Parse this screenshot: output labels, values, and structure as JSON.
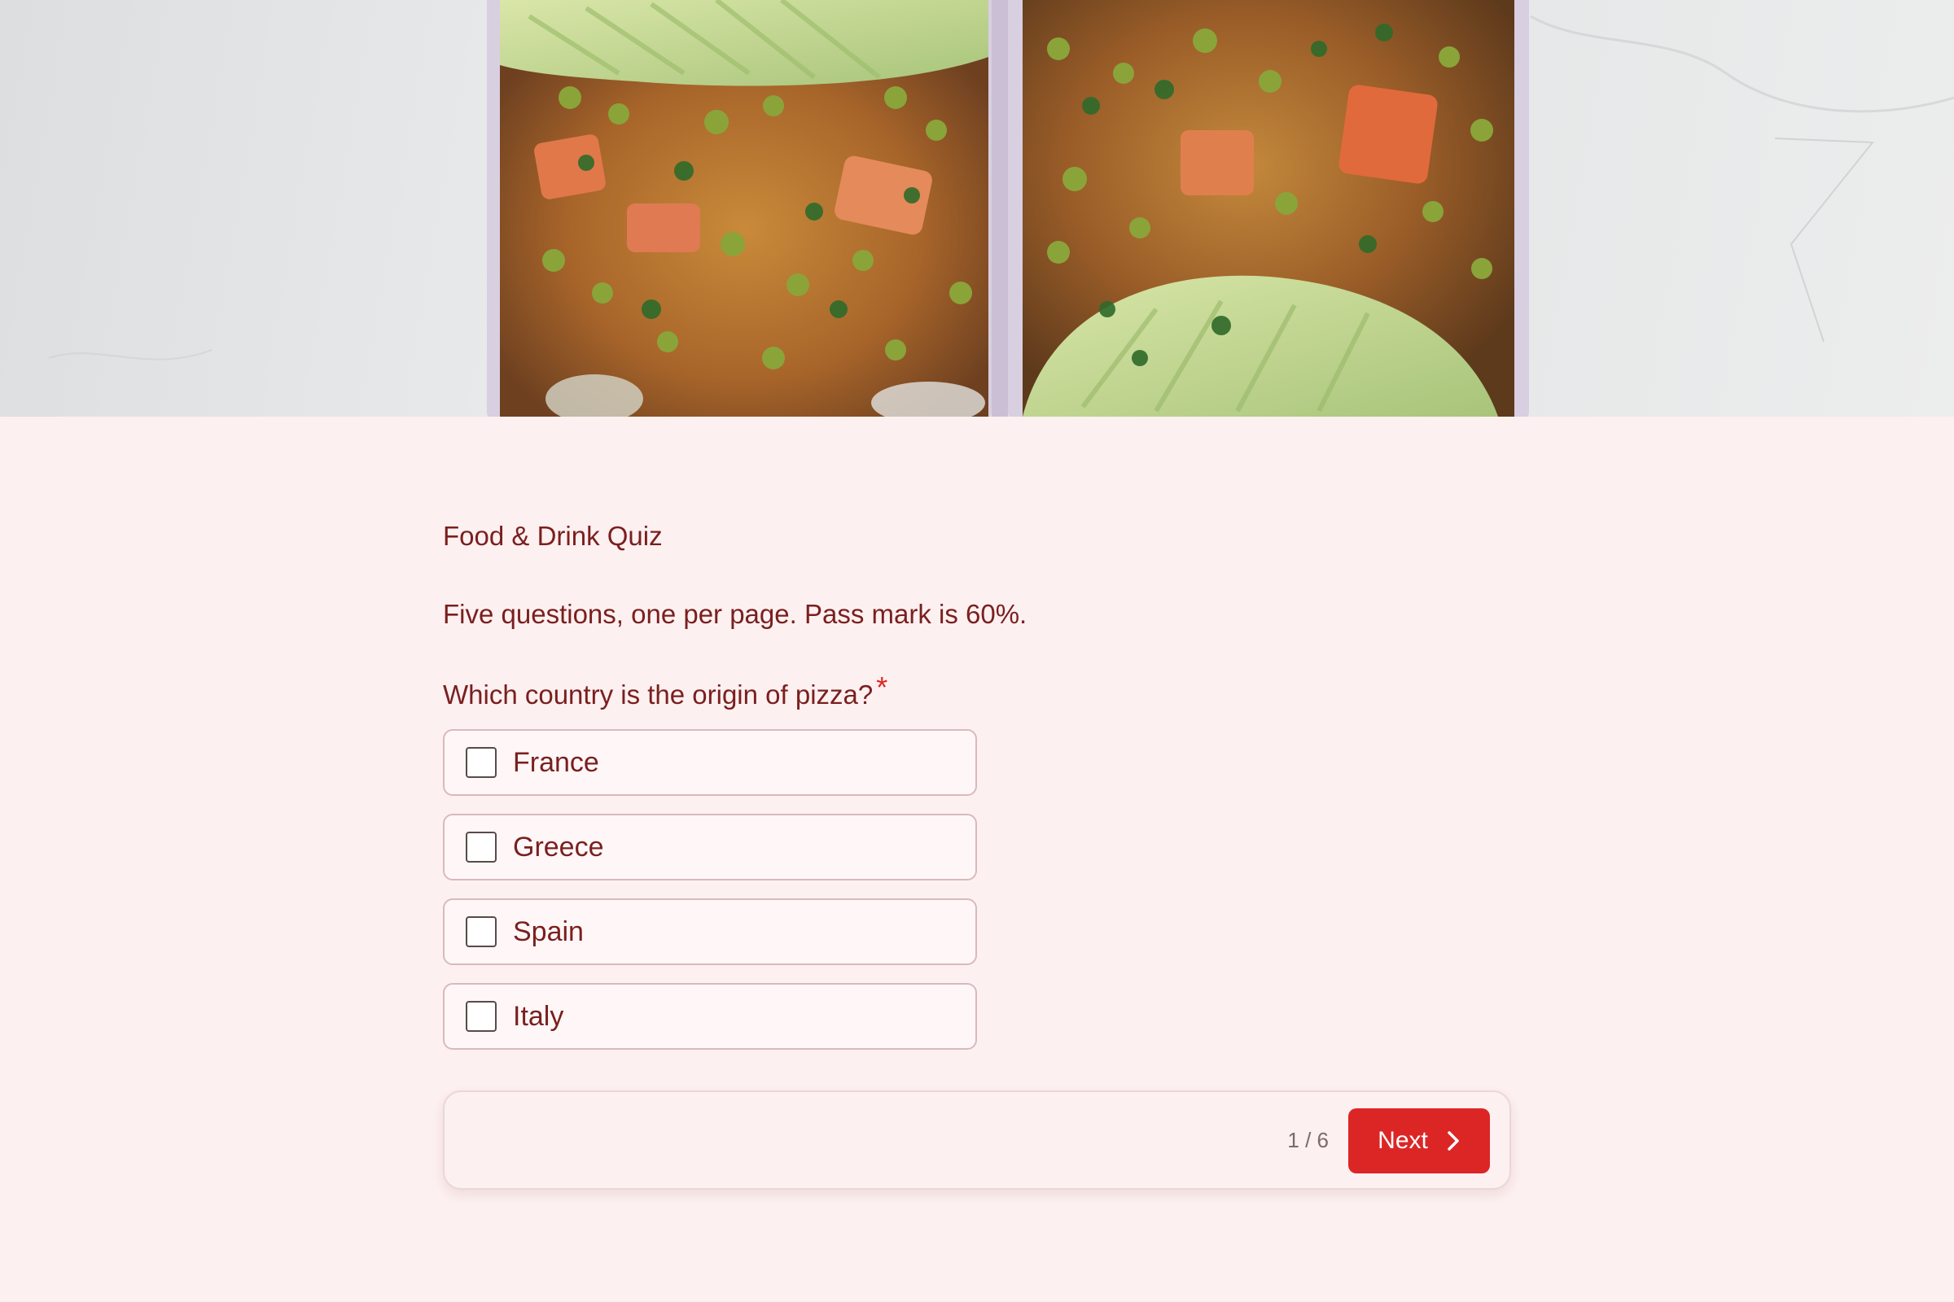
{
  "hero": {
    "image": "food-bowls-curry-avocado-photo"
  },
  "form": {
    "title": "Food & Drink Quiz",
    "description": "Five questions, one per page. Pass mark is 60%.",
    "question": "Which country is the origin of pizza?",
    "required_marker": "*",
    "options": [
      {
        "label": "France",
        "checked": false
      },
      {
        "label": "Greece",
        "checked": false
      },
      {
        "label": "Spain",
        "checked": false
      },
      {
        "label": "Italy",
        "checked": false
      }
    ]
  },
  "footer": {
    "page_counter": "1 / 6",
    "next_label": "Next",
    "next_icon": "chevron-right-icon"
  },
  "colors": {
    "page_background": "#fdf0f0",
    "text": "#7a1f1f",
    "accent": "#dc2626",
    "option_border": "#d9b9bd"
  }
}
